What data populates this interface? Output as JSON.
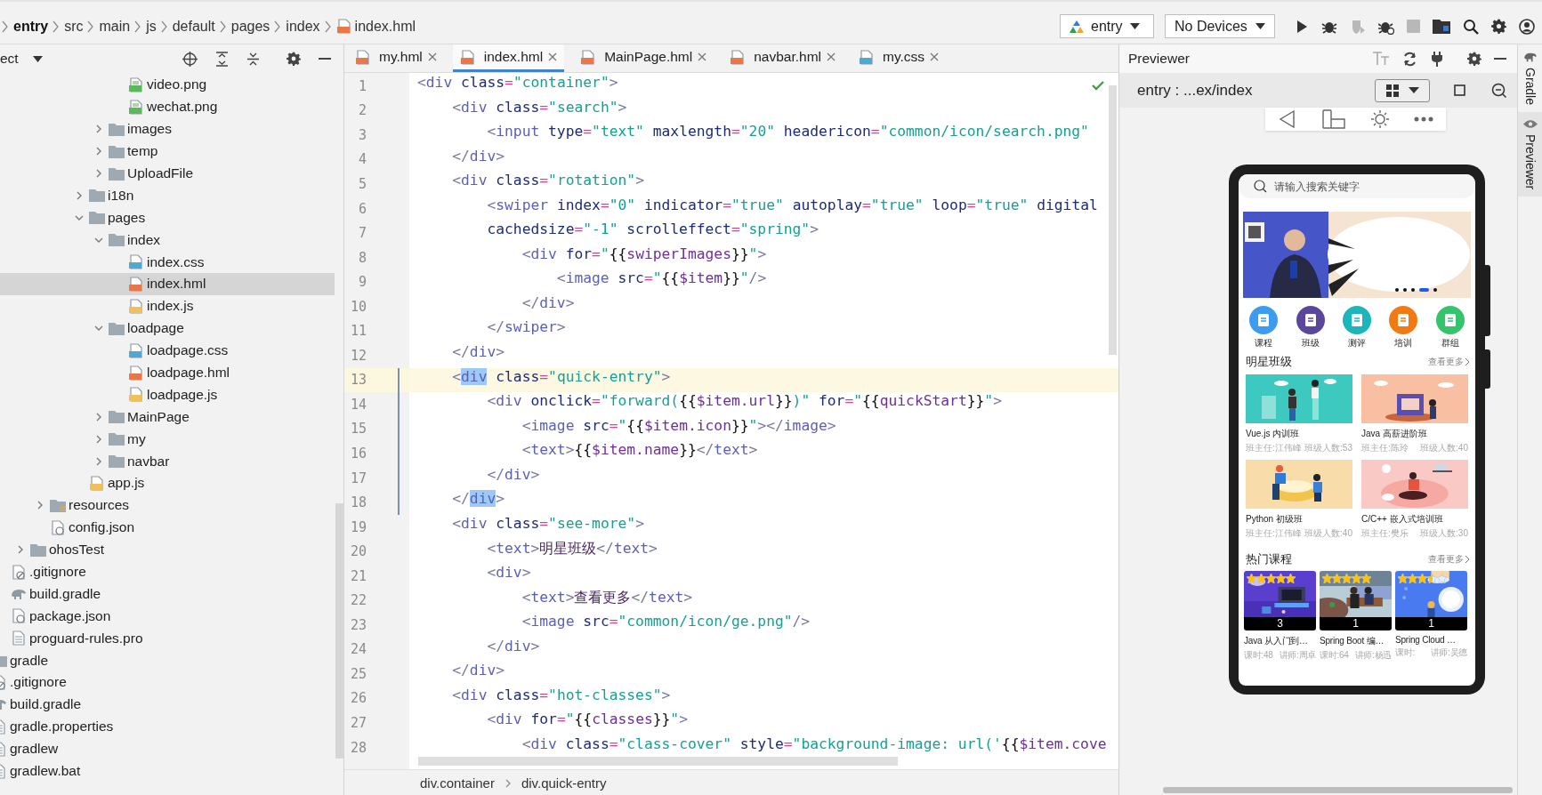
{
  "breadcrumb": [
    {
      "label": "entry",
      "kind": "plain"
    },
    {
      "label": "src",
      "kind": "plain"
    },
    {
      "label": "main",
      "kind": "plain"
    },
    {
      "label": "js",
      "kind": "plain"
    },
    {
      "label": "default",
      "kind": "plain"
    },
    {
      "label": "pages",
      "kind": "plain"
    },
    {
      "label": "index",
      "kind": "plain"
    },
    {
      "label": "index.hml",
      "kind": "hml"
    }
  ],
  "toolbar": {
    "module": "entry",
    "device": "No Devices"
  },
  "project": {
    "title": "ect",
    "tree": [
      {
        "children": [
          {
            "children": [
              {
                "children": [
                  {
                    "children": [
                      {
                        "children": [
                          {
                            "children": [
                              {
                                "children": [
                                  {
                                    "label": "video.png",
                                    "kind": "png",
                                    "selected": false
                                  },
                                  {
                                    "label": "wechat.png",
                                    "kind": "png",
                                    "selected": false
                                  }
                                ]
                              },
                              {
                                "label": "images",
                                "kind": "folder",
                                "expanded": false,
                                "selected": false
                              },
                              {
                                "label": "temp",
                                "kind": "folder",
                                "expanded": false,
                                "selected": false
                              },
                              {
                                "label": "UploadFile",
                                "kind": "folder",
                                "expanded": false,
                                "selected": false
                              }
                            ]
                          },
                          {
                            "label": "i18n",
                            "kind": "folder",
                            "expanded": false,
                            "selected": false
                          },
                          {
                            "label": "pages",
                            "kind": "folder",
                            "expanded": true,
                            "selected": false,
                            "children": [
                              {
                                "label": "index",
                                "kind": "folder",
                                "expanded": true,
                                "selected": false,
                                "children": [
                                  {
                                    "label": "index.css",
                                    "kind": "css",
                                    "selected": false
                                  },
                                  {
                                    "label": "index.hml",
                                    "kind": "hml",
                                    "selected": true
                                  },
                                  {
                                    "label": "index.js",
                                    "kind": "js",
                                    "selected": false
                                  }
                                ]
                              },
                              {
                                "label": "loadpage",
                                "kind": "folder",
                                "expanded": true,
                                "selected": false,
                                "children": [
                                  {
                                    "label": "loadpage.css",
                                    "kind": "css",
                                    "selected": false
                                  },
                                  {
                                    "label": "loadpage.hml",
                                    "kind": "hml",
                                    "selected": false
                                  },
                                  {
                                    "label": "loadpage.js",
                                    "kind": "js",
                                    "selected": false
                                  }
                                ]
                              },
                              {
                                "label": "MainPage",
                                "kind": "folder",
                                "expanded": false,
                                "selected": false
                              },
                              {
                                "label": "my",
                                "kind": "folder",
                                "expanded": false,
                                "selected": false
                              },
                              {
                                "label": "navbar",
                                "kind": "folder",
                                "expanded": false,
                                "selected": false
                              }
                            ]
                          },
                          {
                            "label": "app.js",
                            "kind": "js",
                            "selected": false
                          }
                        ]
                      }
                    ]
                  },
                  {
                    "label": "resources",
                    "kind": "resfolder",
                    "expanded": false,
                    "selected": false
                  },
                  {
                    "label": "config.json",
                    "kind": "json",
                    "selected": false
                  }
                ]
              },
              {
                "label": "ohosTest",
                "kind": "folder",
                "expanded": false,
                "selected": false
              }
            ]
          },
          {
            "label": ".gitignore",
            "kind": "ignore",
            "selected": false
          },
          {
            "label": "build.gradle",
            "kind": "gradle",
            "selected": false
          },
          {
            "label": "package.json",
            "kind": "json",
            "selected": false
          },
          {
            "label": "proguard-rules.pro",
            "kind": "text",
            "selected": false
          }
        ]
      },
      {
        "label": "gradle",
        "kind": "folder",
        "selected": false
      },
      {
        "label": ".gitignore",
        "kind": "ignore",
        "selected": false
      },
      {
        "label": "build.gradle",
        "kind": "gradle",
        "selected": false
      },
      {
        "label": "gradle.properties",
        "kind": "text",
        "selected": false
      },
      {
        "label": "gradlew",
        "kind": "text",
        "selected": false
      },
      {
        "label": "gradlew.bat",
        "kind": "text",
        "selected": false
      }
    ]
  },
  "tabs": [
    {
      "label": "my.hml",
      "kind": "hml",
      "selected": false
    },
    {
      "label": "index.hml",
      "kind": "hml",
      "selected": true
    },
    {
      "label": "MainPage.hml",
      "kind": "hml",
      "selected": false
    },
    {
      "label": "navbar.hml",
      "kind": "hml",
      "selected": false
    },
    {
      "label": "my.css",
      "kind": "css",
      "selected": false
    }
  ],
  "editor": {
    "lines": [
      {
        "number": "1",
        "text": "<div class=\"container\">",
        "current": false,
        "modified": false,
        "match": false
      },
      {
        "number": "2",
        "text": "    <div class=\"search\">",
        "current": false,
        "modified": false,
        "match": false
      },
      {
        "number": "3",
        "text": "        <input type=\"text\" maxlength=\"20\" headericon=\"common/icon/search.png\"",
        "current": false,
        "modified": false,
        "match": false
      },
      {
        "number": "4",
        "text": "    </div>",
        "current": false,
        "modified": false,
        "match": false
      },
      {
        "number": "5",
        "text": "    <div class=\"rotation\">",
        "current": false,
        "modified": false,
        "match": false
      },
      {
        "number": "6",
        "text": "        <swiper index=\"0\" indicator=\"true\" autoplay=\"true\" loop=\"true\" digital",
        "current": false,
        "modified": false,
        "match": false
      },
      {
        "number": "7",
        "text": "        cachedsize=\"-1\" scrolleffect=\"spring\">",
        "current": false,
        "modified": false,
        "match": false
      },
      {
        "number": "8",
        "text": "            <div for=\"{{swiperImages}}\">",
        "current": false,
        "modified": false,
        "match": false
      },
      {
        "number": "9",
        "text": "                <image src=\"{{$item}}\"/>",
        "current": false,
        "modified": false,
        "match": false
      },
      {
        "number": "10",
        "text": "            </div>",
        "current": false,
        "modified": false,
        "match": false
      },
      {
        "number": "11",
        "text": "        </swiper>",
        "current": false,
        "modified": false,
        "match": false
      },
      {
        "number": "12",
        "text": "    </div>",
        "current": false,
        "modified": false,
        "match": false
      },
      {
        "number": "13",
        "text": "    <div class=\"quick-entry\">",
        "current": true,
        "modified": true,
        "match": true
      },
      {
        "number": "14",
        "text": "        <div onclick=\"forward({{$item.url}})\" for=\"{{quickStart}}\">",
        "current": false,
        "modified": true,
        "match": false
      },
      {
        "number": "15",
        "text": "            <image src=\"{{$item.icon}}\"></image>",
        "current": false,
        "modified": true,
        "match": false
      },
      {
        "number": "16",
        "text": "            <text>{{$item.name}}</text>",
        "current": false,
        "modified": true,
        "match": false
      },
      {
        "number": "17",
        "text": "        </div>",
        "current": false,
        "modified": true,
        "match": false
      },
      {
        "number": "18",
        "text": "    </div>",
        "current": false,
        "modified": true,
        "match": true
      },
      {
        "number": "19",
        "text": "    <div class=\"see-more\">",
        "current": false,
        "modified": false,
        "match": false
      },
      {
        "number": "20",
        "text": "        <text>明星班级</text>",
        "current": false,
        "modified": false,
        "match": false
      },
      {
        "number": "21",
        "text": "        <div>",
        "current": false,
        "modified": false,
        "match": false
      },
      {
        "number": "22",
        "text": "            <text>查看更多</text>",
        "current": false,
        "modified": false,
        "match": false
      },
      {
        "number": "23",
        "text": "            <image src=\"common/icon/ge.png\"/>",
        "current": false,
        "modified": false,
        "match": false
      },
      {
        "number": "24",
        "text": "        </div>",
        "current": false,
        "modified": false,
        "match": false
      },
      {
        "number": "25",
        "text": "    </div>",
        "current": false,
        "modified": false,
        "match": false
      },
      {
        "number": "26",
        "text": "    <div class=\"hot-classes\">",
        "current": false,
        "modified": false,
        "match": false
      },
      {
        "number": "27",
        "text": "        <div for=\"{{classes}}\">",
        "current": false,
        "modified": false,
        "match": false
      },
      {
        "number": "28",
        "text": "            <div class=\"class-cover\" style=\"background-image: url('{{$item.cove",
        "current": false,
        "modified": false,
        "match": false
      }
    ],
    "breadcrumb": [
      "div.container",
      "div.quick-entry"
    ]
  },
  "previewer": {
    "title": "Previewer",
    "path": "entry : ...ex/index",
    "app": {
      "search": {
        "placeholder": "请输入搜索关键字"
      },
      "banner": {
        "kind": "picture",
        "indicator": [
          {
            "selected": false
          },
          {
            "selected": false
          },
          {
            "selected": false
          },
          {
            "selected": true
          },
          {
            "selected": false
          }
        ]
      },
      "quick_entries": [
        {
          "label": "课程",
          "color": "#3d9cf0"
        },
        {
          "label": "班级",
          "color": "#5a479c"
        },
        {
          "label": "测评",
          "color": "#1bb5bb"
        },
        {
          "label": "培训",
          "color": "#f27a12"
        },
        {
          "label": "群组",
          "color": "#35c46b"
        }
      ],
      "star_classes": {
        "title": "明星班级",
        "more": "查看更多",
        "items": [
          {
            "name": "Vue.js 内训班",
            "teacher": "班主任:江伟峰",
            "count": "班级人数:53"
          },
          {
            "name": "Java 高薪进阶班",
            "teacher": "班主任:陈玲",
            "count": "班级人数:40"
          },
          {
            "name": "Python 初级班",
            "teacher": "班主任:江伟峰",
            "count": "班级人数:40"
          },
          {
            "name": "C/C++ 嵌入式培训班",
            "teacher": "班主任:樊乐",
            "count": "班级人数:30"
          }
        ]
      },
      "hot_courses": {
        "title": "热门课程",
        "more": "查看更多",
        "items": [
          {
            "stars": 5,
            "badge": "3",
            "name": "Java 从入门到…",
            "hours": "课时:48",
            "lecturer": "讲师:周卓"
          },
          {
            "stars": 5,
            "badge": "1",
            "name": "Spring Boot 编…",
            "hours": "课时:64",
            "lecturer": "讲师:杨迅"
          },
          {
            "stars": 3.5,
            "badge": "1",
            "name": "Spring Cloud …",
            "hours": "课时:",
            "lecturer": "讲师:吴德"
          }
        ]
      }
    }
  },
  "side_tabs": [
    {
      "label": "Gradle",
      "kind": "gradle",
      "selected": false
    },
    {
      "label": "Previewer",
      "kind": "eye",
      "selected": true
    }
  ]
}
